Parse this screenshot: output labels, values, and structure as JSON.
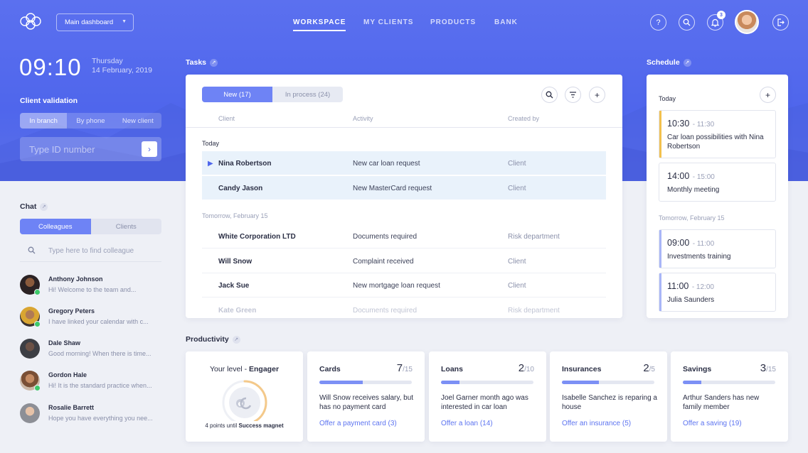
{
  "nav": {
    "dashboard_select": "Main dashboard",
    "items": [
      "WORKSPACE",
      "MY CLIENTS",
      "PRODUCTS",
      "BANK"
    ],
    "notifications_count": "3"
  },
  "hero": {
    "time": "09:10",
    "day": "Thursday",
    "date": "14 February, 2019",
    "client_validation_label": "Client validation",
    "validation_tabs": [
      "In branch",
      "By phone",
      "New client"
    ],
    "id_placeholder": "Type ID number"
  },
  "chat": {
    "title": "Chat",
    "tabs": [
      "Colleagues",
      "Clients"
    ],
    "search_placeholder": "Type here to find colleague",
    "contacts": [
      {
        "name": "Anthony Johnson",
        "message": "Hi! Welcome to the team and...",
        "online": true
      },
      {
        "name": "Gregory Peters",
        "message": "I have linked your calendar with c...",
        "online": true
      },
      {
        "name": "Dale Shaw",
        "message": "Good morning! When there is time...",
        "online": false
      },
      {
        "name": "Gordon Hale",
        "message": "Hi! It is the standard practice when...",
        "online": true
      },
      {
        "name": "Rosalie Barrett",
        "message": "Hope you have everything you nee...",
        "online": false
      }
    ]
  },
  "tasks": {
    "title": "Tasks",
    "tabs": [
      "New (17)",
      "In process (24)"
    ],
    "columns": [
      "Client",
      "Activity",
      "Created by"
    ],
    "group_today": "Today",
    "group_tomorrow": "Tomorrow, February 15",
    "today_rows": [
      {
        "client": "Nina Robertson",
        "activity": "New car loan request",
        "created_by": "Client",
        "flagged": true
      },
      {
        "client": "Candy Jason",
        "activity": "New MasterCard request",
        "created_by": "Client",
        "flagged": false
      }
    ],
    "tomorrow_rows": [
      {
        "client": "White Corporation LTD",
        "activity": "Documents required",
        "created_by": "Risk department"
      },
      {
        "client": "Will Snow",
        "activity": "Complaint received",
        "created_by": "Client"
      },
      {
        "client": "Jack Sue",
        "activity": "New mortgage loan request",
        "created_by": "Client"
      },
      {
        "client": "Kate Green",
        "activity": "Documents required",
        "created_by": "Risk department"
      }
    ]
  },
  "schedule": {
    "title": "Schedule",
    "today_label": "Today",
    "tomorrow_label": "Tomorrow, February 15",
    "today_events": [
      {
        "start": "10:30",
        "end": "- 11:30",
        "title": "Car loan possibilities with Nina Robertson",
        "color": "#f2c14e"
      },
      {
        "start": "14:00",
        "end": "- 15:00",
        "title": "Monthly meeting",
        "color": "#e2e5ee"
      }
    ],
    "tomorrow_events": [
      {
        "start": "09:00",
        "end": "- 11:00",
        "title": "Investments training",
        "color": "#a9b6f7"
      },
      {
        "start": "11:00",
        "end": "- 12:00",
        "title": "Julia Saunders",
        "color": "#a9b6f7"
      }
    ]
  },
  "productivity": {
    "title": "Productivity",
    "level_prefix": "Your level - ",
    "level_name": "Engager",
    "points_prefix": "4 points until ",
    "points_target": "Success magnet",
    "level_progress": 0.42,
    "cards": [
      {
        "title": "Cards",
        "count": "7",
        "total": "/15",
        "progress": 0.47,
        "desc": "Will Snow receives salary, but has no payment card",
        "link": "Offer a payment card (3)"
      },
      {
        "title": "Loans",
        "count": "2",
        "total": "/10",
        "progress": 0.2,
        "desc": "Joel Garner month ago was interested in car loan",
        "link": "Offer a loan (14)"
      },
      {
        "title": "Insurances",
        "count": "2",
        "total": "/5",
        "progress": 0.4,
        "desc": "Isabelle Sanchez is reparing a house",
        "link": "Offer an insurance (5)"
      },
      {
        "title": "Savings",
        "count": "3",
        "total": "/15",
        "progress": 0.2,
        "desc": "Arthur Sanders has new family member",
        "link": "Offer a saving (19)"
      }
    ]
  },
  "colors": {
    "accent": "#6e83f5",
    "hero": "#5468ee",
    "online": "#3ec96a"
  }
}
